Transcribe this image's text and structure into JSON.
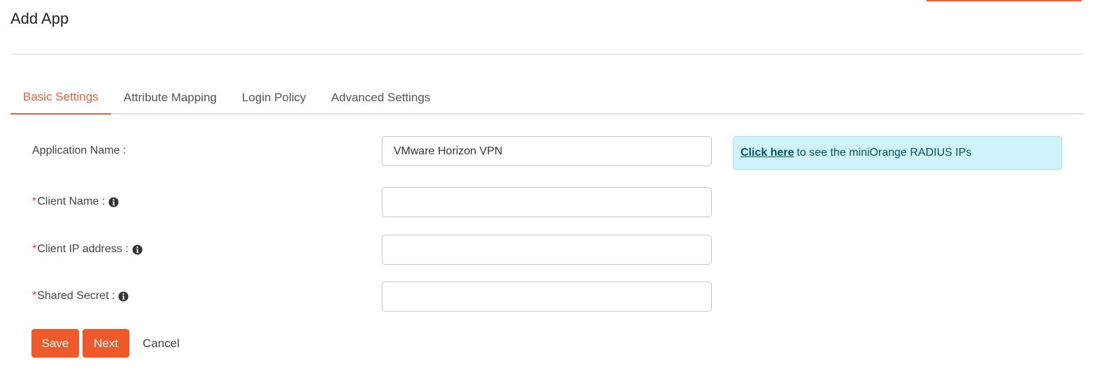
{
  "page": {
    "title": "Add App"
  },
  "tabs": [
    {
      "label": "Basic Settings",
      "active": true
    },
    {
      "label": "Attribute Mapping",
      "active": false
    },
    {
      "label": "Login Policy",
      "active": false
    },
    {
      "label": "Advanced Settings",
      "active": false
    }
  ],
  "form": {
    "application_name": {
      "label": "Application Name :",
      "value": "VMware Horizon VPN"
    },
    "client_name": {
      "required_mark": "*",
      "label": "Client Name :",
      "value": "",
      "icon": "info-circle-icon"
    },
    "client_ip": {
      "required_mark": "*",
      "label": "Client IP address :",
      "value": "",
      "icon": "info-circle-icon"
    },
    "shared_secret": {
      "required_mark": "*",
      "label": "Shared Secret :",
      "value": "",
      "icon": "info-circle-icon"
    }
  },
  "info_box": {
    "link_text": "Click here",
    "text": "to see the miniOrange RADIUS IPs"
  },
  "actions": {
    "save_label": "Save",
    "next_label": "Next",
    "cancel_label": "Cancel"
  },
  "colors": {
    "accent": "#ee5a2b",
    "active_tab": "#e8603c",
    "info_bg": "#cff4fc",
    "required": "#e53935"
  }
}
